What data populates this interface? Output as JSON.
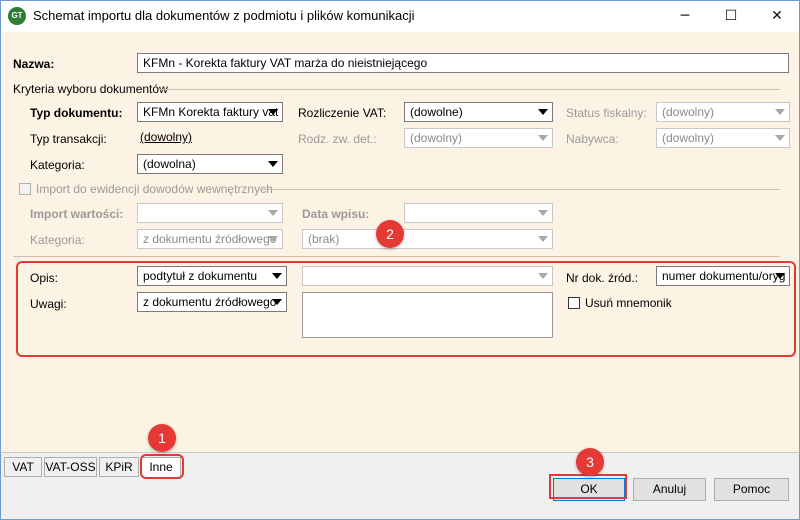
{
  "window": {
    "title": "Schemat importu dla dokumentów z podmiotu i plików komunikacji",
    "icon_label": "GT",
    "minimize": "─",
    "maximize": "☐",
    "close": "✕"
  },
  "header": {
    "name_label": "Nazwa:",
    "name_value": "KFMn - Korekta faktury VAT marża do nieistniejącego"
  },
  "criteria": {
    "section_label": "Kryteria wyboru dokumentów",
    "doc_type_label": "Typ dokumentu:",
    "doc_type_value": "KFMn Korekta faktury vat",
    "vat_settlement_label": "Rozliczenie VAT:",
    "vat_settlement_value": "(dowolne)",
    "fiscal_status_label": "Status fiskalny:",
    "fiscal_status_value": "(dowolny)",
    "transaction_type_label": "Typ transakcji:",
    "transaction_type_value": "(dowolny)",
    "exempt_type_label": "Rodz. zw. det.:",
    "exempt_type_value": "(dowolny)",
    "buyer_label": "Nabywca:",
    "buyer_value": "(dowolny)",
    "category_label": "Kategoria:",
    "category_value": "(dowolna)"
  },
  "internal_import": {
    "checkbox_label": "Import do ewidencji dowodów wewnętrznych",
    "values_label": "Import wartości:",
    "values_value": "",
    "entry_date_label": "Data wpisu:",
    "entry_date_value": "",
    "category_label": "Kategoria:",
    "category_value": "z dokumentu źródłowego",
    "brak_value": "(brak)"
  },
  "description": {
    "opis_label": "Opis:",
    "opis_value": "podtytuł z dokumentu",
    "opis_extra_value": "",
    "uwagi_label": "Uwagi:",
    "uwagi_value": "z dokumentu źródłowego",
    "source_doc_no_label": "Nr dok. źród.:",
    "source_doc_no_value": "numer dokumentu/oryg",
    "remove_mnemonic_label": "Usuń mnemonik"
  },
  "tabs": [
    {
      "label": "VAT"
    },
    {
      "label": "VAT-OSS"
    },
    {
      "label": "KPiR"
    },
    {
      "label": "Inne"
    }
  ],
  "buttons": {
    "ok": "OK",
    "cancel": "Anuluj",
    "help": "Pomoc"
  },
  "badges": [
    "1",
    "2",
    "3"
  ],
  "colors": {
    "annotation_red": "#e53935",
    "client_background": "#fdf3e4",
    "window_border": "#6b9bd1",
    "default_button_border": "#0078d7"
  }
}
